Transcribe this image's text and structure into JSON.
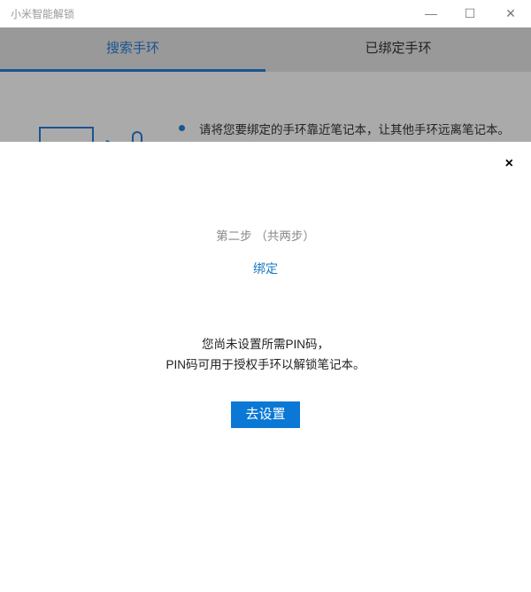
{
  "window": {
    "title": "小米智能解锁",
    "minimize": "—",
    "maximize": "☐",
    "close": "✕"
  },
  "tabs": [
    {
      "label": "搜索手环",
      "active": true
    },
    {
      "label": "已绑定手环",
      "active": false
    }
  ],
  "content": {
    "hint": "请将您要绑定的手环靠近笔记本，让其他手环远离笔记本。"
  },
  "dialog": {
    "close": "×",
    "step": "第二步 （共两步）",
    "stage": "绑定",
    "message_line1": "您尚未设置所需PIN码，",
    "message_line2": "PIN码可用于授权手环以解锁笔记本。",
    "button": "去设置"
  },
  "colors": {
    "accent": "#1a5590",
    "button": "#0a78d4"
  }
}
